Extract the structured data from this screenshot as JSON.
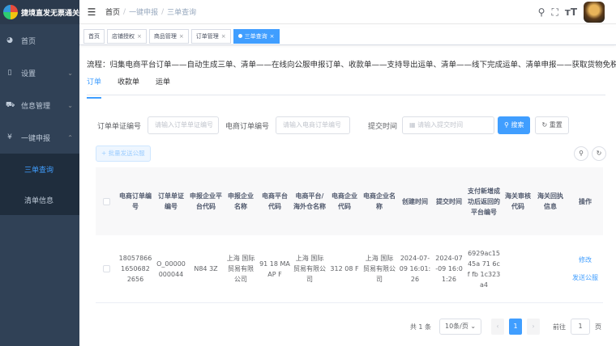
{
  "sidebar": {
    "title": "捷境直发无票通关系统",
    "items": [
      {
        "label": "首页",
        "icon": "dashboard-icon"
      },
      {
        "label": "设置",
        "icon": "settings-icon"
      },
      {
        "label": "信息管理",
        "icon": "cart-icon"
      },
      {
        "label": "一键申报",
        "icon": "yen-icon"
      }
    ],
    "sub_items": [
      {
        "label": "三单查询",
        "active": true
      },
      {
        "label": "清单信息",
        "active": false
      }
    ]
  },
  "navbar": {
    "breadcrumb": [
      "首页",
      "一键申报",
      "三单查询"
    ],
    "separator": "/",
    "icons": [
      "search-icon",
      "fullscreen-icon",
      "font-size-icon"
    ]
  },
  "tags": [
    {
      "label": "首页",
      "active": false,
      "closable": false
    },
    {
      "label": "店铺授权",
      "active": false,
      "closable": true
    },
    {
      "label": "商品管理",
      "active": false,
      "closable": true
    },
    {
      "label": "订单管理",
      "active": false,
      "closable": true
    },
    {
      "label": "三单查询",
      "active": true,
      "closable": true
    }
  ],
  "main": {
    "flow_text": "流程：归集电商平台订单——自动生成三单、清单——在线向公服申报订单、收款单——支持导出运单、清单——线下完成运单、清单申报——获取货物免税明细表",
    "tabs": [
      {
        "label": "订单",
        "active": true
      },
      {
        "label": "收款单",
        "active": false
      },
      {
        "label": "运单",
        "active": false
      }
    ],
    "search": {
      "field1_label": "订单单证编号",
      "field1_placeholder": "请输入订单单证编号",
      "field2_label": "电商订单编号",
      "field2_placeholder": "请输入电商订单编号",
      "field3_label": "提交时间",
      "field3_placeholder": "请输入提交时间",
      "search_button": "搜索",
      "reset_button": "重置"
    },
    "batch_button": "批量发送公服"
  },
  "table": {
    "headers": [
      "电商订单编号",
      "订单单证编号",
      "申报企业平台代码",
      "申报企业名称",
      "电商平台代码",
      "电商平台/海外仓名称",
      "电商企业代码",
      "电商企业名称",
      "创建时间",
      "提交时间",
      "支付新增成功后返回的平台编号",
      "海关审核代码",
      "海关回执信息",
      "操作"
    ],
    "rows": [
      {
        "cells": [
          "180578661650682 2656",
          "O_00000000044",
          "N84 3Z",
          "上海 国际贸易有限公司",
          "91 18 MA AP F",
          "上海 国际贸易有限公司",
          "312 08 F",
          "上海 国际贸易有限公司",
          "2024-07-09 16:01:26",
          "2024-07-09 16:01:26",
          "6929ac15 45a 71 6cf fb 1c323a4",
          "",
          ""
        ],
        "actions": [
          "修改",
          "发送公服"
        ]
      }
    ]
  },
  "pagination": {
    "total": "共 1 条",
    "page_size": "10条/页",
    "current_page": "1",
    "goto_label": "前往",
    "goto_value": "1",
    "page_suffix": "页"
  }
}
